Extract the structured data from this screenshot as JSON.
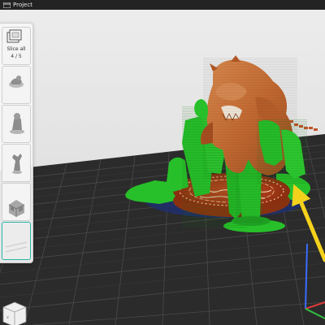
{
  "window": {
    "title": "Project",
    "menu_icon": "hamburger-menu-icon"
  },
  "sidebar": {
    "slice_all_label": "Slice all",
    "counter": "4 / 5",
    "thumbnails": [
      {
        "name": "slice-all-thumbnail"
      },
      {
        "name": "model-thumbnail-1"
      },
      {
        "name": "model-thumbnail-2"
      },
      {
        "name": "model-thumbnail-3"
      },
      {
        "name": "model-thumbnail-4"
      },
      {
        "name": "model-thumbnail-5",
        "selected": true
      }
    ]
  },
  "colors": {
    "model": "#c56a32",
    "supports": "#27c02a",
    "build_plate": "#2d2d2d",
    "accent": "#2bb4aa",
    "annotation_arrow": "#f4d21c"
  }
}
